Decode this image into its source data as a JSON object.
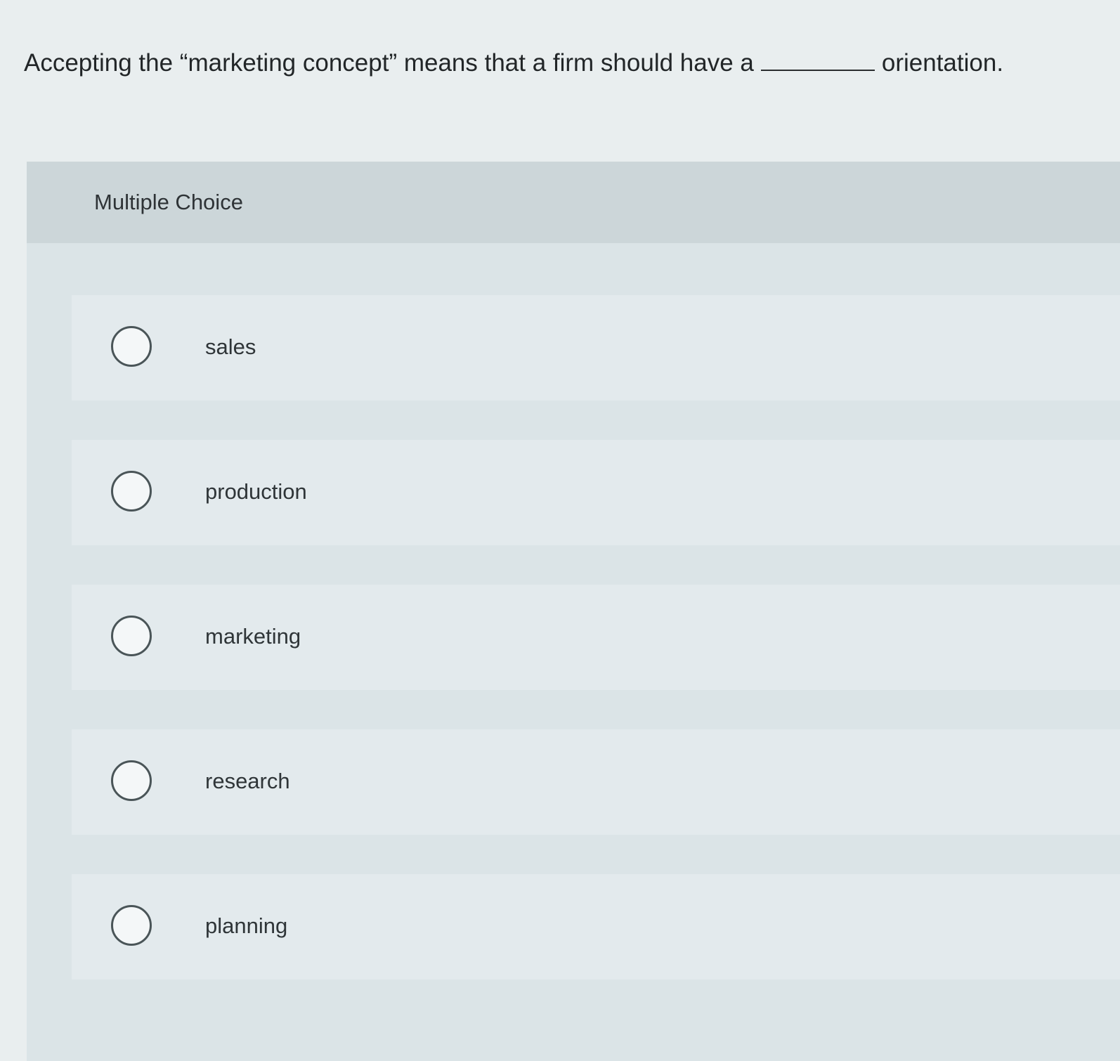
{
  "question": {
    "text_before": "Accepting the “marketing concept” means that a firm should have a",
    "text_after": "orientation."
  },
  "multiple_choice": {
    "heading": "Multiple Choice",
    "options": [
      {
        "label": "sales",
        "selected": false
      },
      {
        "label": "production",
        "selected": false
      },
      {
        "label": "marketing",
        "selected": false
      },
      {
        "label": "research",
        "selected": false
      },
      {
        "label": "planning",
        "selected": false
      }
    ]
  }
}
